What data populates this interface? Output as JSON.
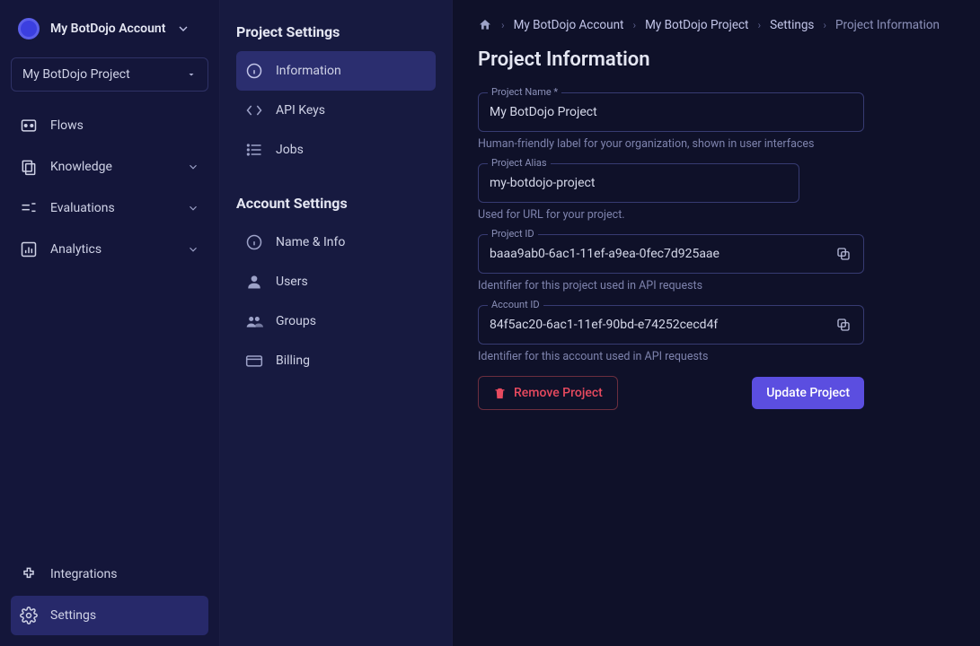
{
  "account": {
    "name": "My BotDojo Account"
  },
  "project_select": {
    "value": "My BotDojo Project"
  },
  "nav": {
    "flows": "Flows",
    "knowledge": "Knowledge",
    "evaluations": "Evaluations",
    "analytics": "Analytics",
    "integrations": "Integrations",
    "settings": "Settings"
  },
  "settings_panel": {
    "project_heading": "Project Settings",
    "account_heading": "Account Settings",
    "project_items": {
      "information": "Information",
      "api_keys": "API Keys",
      "jobs": "Jobs"
    },
    "account_items": {
      "name_info": "Name & Info",
      "users": "Users",
      "groups": "Groups",
      "billing": "Billing"
    }
  },
  "breadcrumb": {
    "account": "My BotDojo Account",
    "project": "My BotDojo Project",
    "settings": "Settings",
    "current": "Project Information"
  },
  "page": {
    "title": "Project Information"
  },
  "fields": {
    "project_name": {
      "label": "Project Name *",
      "value": "My BotDojo Project",
      "helper": "Human-friendly label for your organization, shown in user interfaces"
    },
    "project_alias": {
      "label": "Project Alias",
      "value": "my-botdojo-project",
      "helper": "Used for URL for your project."
    },
    "project_id": {
      "label": "Project ID",
      "value": "baaa9ab0-6ac1-11ef-a9ea-0fec7d925aae",
      "helper": "Identifier for this project used in API requests"
    },
    "account_id": {
      "label": "Account ID",
      "value": "84f5ac20-6ac1-11ef-90bd-e74252cecd4f",
      "helper": "Identifier for this account used in API requests"
    }
  },
  "buttons": {
    "remove": "Remove Project",
    "update": "Update Project"
  }
}
